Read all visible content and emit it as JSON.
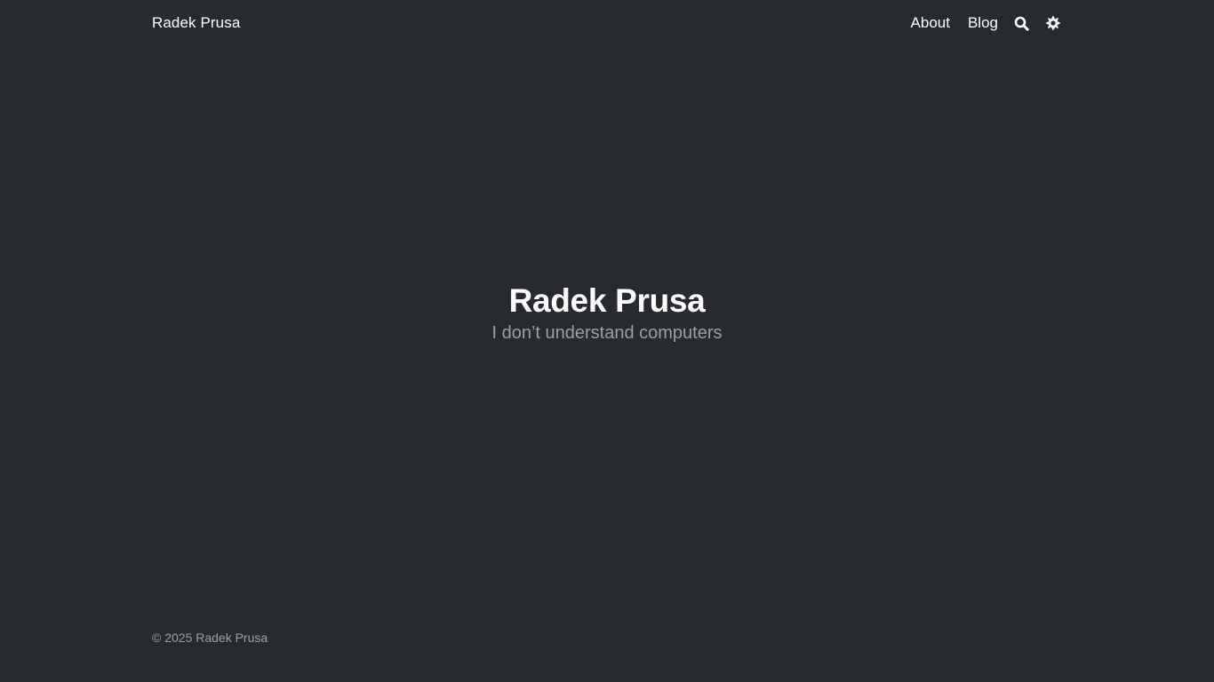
{
  "nav": {
    "brand": "Radek Prusa",
    "links": [
      {
        "label": "About"
      },
      {
        "label": "Blog"
      }
    ],
    "icons": [
      "search-icon",
      "theme-toggle-icon"
    ]
  },
  "hero": {
    "title": "Radek Prusa",
    "subtitle": "I don’t understand computers"
  },
  "footer": {
    "copyright": "© 2025 Radek Prusa"
  },
  "colors": {
    "background": "#272b30",
    "text": "#ffffff",
    "muted": "#9aa0a6"
  }
}
